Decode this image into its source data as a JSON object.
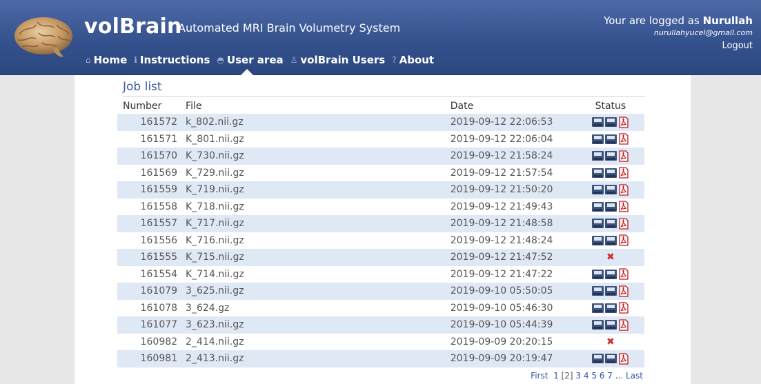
{
  "header": {
    "logo_title": "volBrain",
    "logo_subtitle": "Automated MRI Brain Volumetry System",
    "nav": [
      {
        "label": "Home",
        "icon": "home-icon"
      },
      {
        "label": "Instructions",
        "icon": "info-icon"
      },
      {
        "label": "User area",
        "icon": "user-area-icon"
      },
      {
        "label": "volBrain Users",
        "icon": "users-icon"
      },
      {
        "label": "About",
        "icon": "question-icon"
      }
    ],
    "active_nav": "User area",
    "user_prefix": "Your are logged as",
    "user_name": "Nurullah",
    "user_email": "nurullahyucel@gmail.com",
    "logout_label": "Logout"
  },
  "job_list": {
    "title": "Job list",
    "columns": [
      "Number",
      "File",
      "Date",
      "Status"
    ],
    "rows": [
      {
        "number": "161572",
        "file": "k_802.nii.gz",
        "date": "2019-09-12 22:06:53",
        "status": "done"
      },
      {
        "number": "161571",
        "file": "K_801.nii.gz",
        "date": "2019-09-12 22:06:04",
        "status": "done"
      },
      {
        "number": "161570",
        "file": "K_730.nii.gz",
        "date": "2019-09-12 21:58:24",
        "status": "done"
      },
      {
        "number": "161569",
        "file": "K_729.nii.gz",
        "date": "2019-09-12 21:57:54",
        "status": "done"
      },
      {
        "number": "161559",
        "file": "K_719.nii.gz",
        "date": "2019-09-12 21:50:20",
        "status": "done"
      },
      {
        "number": "161558",
        "file": "K_718.nii.gz",
        "date": "2019-09-12 21:49:43",
        "status": "done"
      },
      {
        "number": "161557",
        "file": "K_717.nii.gz",
        "date": "2019-09-12 21:48:58",
        "status": "done"
      },
      {
        "number": "161556",
        "file": "K_716.nii.gz",
        "date": "2019-09-12 21:48:24",
        "status": "done"
      },
      {
        "number": "161555",
        "file": "K_715.nii.gz",
        "date": "2019-09-12 21:47:52",
        "status": "error"
      },
      {
        "number": "161554",
        "file": "K_714.nii.gz",
        "date": "2019-09-12 21:47:22",
        "status": "done"
      },
      {
        "number": "161079",
        "file": "3_625.nii.gz",
        "date": "2019-09-10 05:50:05",
        "status": "done"
      },
      {
        "number": "161078",
        "file": "3_624.gz",
        "date": "2019-09-10 05:46:30",
        "status": "done"
      },
      {
        "number": "161077",
        "file": "3_623.nii.gz",
        "date": "2019-09-10 05:44:39",
        "status": "done"
      },
      {
        "number": "160982",
        "file": "2_414.nii.gz",
        "date": "2019-09-09 20:20:15",
        "status": "error"
      },
      {
        "number": "160981",
        "file": "2_413.nii.gz",
        "date": "2019-09-09 20:19:47",
        "status": "done"
      }
    ],
    "status_icons": {
      "done": [
        "save-mri-icon",
        "save-nat-icon",
        "pdf-icon"
      ],
      "error": [
        "error-x-icon"
      ]
    }
  },
  "pagination": {
    "first": "First",
    "pages": [
      "1",
      "[2]",
      "3",
      "4",
      "5",
      "6",
      "7"
    ],
    "ellipsis": "...",
    "last": "Last"
  },
  "colors": {
    "header_bg": "#35528f",
    "row_alt": "#dfe8f5",
    "link": "#2e56a6",
    "title": "#3b5a99",
    "error": "#d22f2f"
  }
}
